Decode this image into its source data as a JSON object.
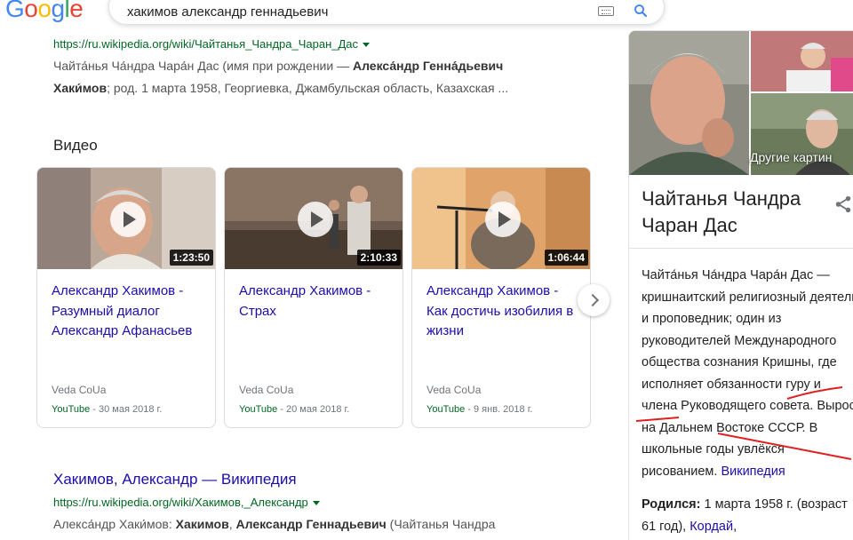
{
  "header": {
    "logo_text": "Google",
    "logo_colors": [
      "#4285F4",
      "#EA4335",
      "#FBBC05",
      "#4285F4",
      "#34A853",
      "#EA4335"
    ],
    "search_query": "хакимов александр геннадьевич",
    "icons": [
      "keyboard-icon",
      "search-icon"
    ]
  },
  "result1": {
    "url": "https://ru.wikipedia.org/wiki/Чайтанья_Чандра_Чаран_Дас",
    "snippet_line1_a": "Чайта́нья Ча́ндра Чара́н Дас (имя при рождении — ",
    "snippet_line1_b": "Алекса́ндр Генна́дьевич",
    "snippet_line2_a": "Хаки́мов",
    "snippet_line2_b": "; род. 1 марта 1958, Георгиевка, Джамбульская область, Казахская ..."
  },
  "videos": {
    "heading": "Видео",
    "items": [
      {
        "title": "Александр Хакимов - Разумный диалог Александр Афанасьев",
        "duration": "1:23:50",
        "channel": "Veda CoUa",
        "source": "YouTube",
        "date": " - 30 мая 2018 г."
      },
      {
        "title": "Александр Хакимов - Страх",
        "duration": "2:10:33",
        "channel": "Veda CoUa",
        "source": "YouTube",
        "date": " - 20 мая 2018 г."
      },
      {
        "title": "Александр Хакимов - Как достичь изобилия в жизни",
        "duration": "1:06:44",
        "channel": "Veda CoUa",
        "source": "YouTube",
        "date": " - 9 янв. 2018 г."
      }
    ],
    "next_icon": "chevron-right-icon"
  },
  "result2": {
    "title": "Хакимов, Александр — Википедия",
    "url": "https://ru.wikipedia.org/wiki/Хакимов,_Александр",
    "snippet_a": "Алекса́ндр Хаки́мов: ",
    "snippet_b": "Хакимов",
    "snippet_c": ", ",
    "snippet_d": "Александр Геннадьевич",
    "snippet_e": " (Чайтанья Чандра"
  },
  "knowledge_panel": {
    "more_images": "Другие картин",
    "title": "Чайтанья Чандра Чаран Дас",
    "description": "Чайта́нья Ча́ндра Чара́н Дас — кришнаитский религиозный деятель и проповедник; один из руководителей Международного общества сознания Кришны, где исполняет обязанности гуру и члена Руководящего совета. Вырос на Дальнем Востоке СССР. В школьные годы увлёкся рисованием. ",
    "source_link": "Википедия",
    "born_label": "Родился:",
    "born_value": " 1 марта 1958 г. (возраст 61 год), ",
    "born_place": "Кордай",
    "born_tail": ","
  }
}
